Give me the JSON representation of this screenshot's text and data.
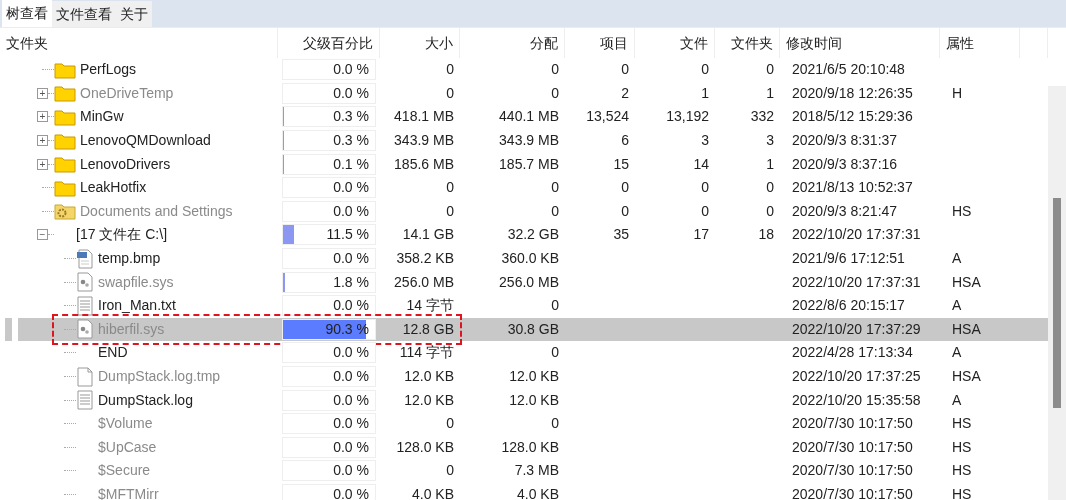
{
  "tabs": [
    {
      "label": "树查看",
      "selected": true
    },
    {
      "label": "文件查看",
      "selected": false
    },
    {
      "label": "关于",
      "selected": false
    }
  ],
  "columns": [
    "文件夹",
    "父级百分比",
    "大小",
    "分配",
    "项目",
    "文件",
    "文件夹",
    "修改时间",
    "属性"
  ],
  "rows": [
    {
      "name": "PerfLogs",
      "kind": "folder",
      "dimmed": false,
      "selected": false,
      "outlined": false,
      "percent": "0.0 %",
      "level": 0,
      "size": "0",
      "allocated": "0",
      "items": "0",
      "files": "0",
      "folders": "0",
      "modified": "2021/6/5 20:10:48"
    },
    {
      "name": "OneDriveTemp",
      "kind": "folder",
      "expander": "+",
      "dimmed": true,
      "selected": false,
      "outlined": false,
      "percent": "0.0 %",
      "level": 0,
      "size": "0",
      "allocated": "0",
      "items": "2",
      "files": "1",
      "folders": "1",
      "modified": "2020/9/18 12:26:35",
      "attributes": "H"
    },
    {
      "name": "MinGw",
      "kind": "folder",
      "expander": "+",
      "dimmed": false,
      "selected": false,
      "outlined": false,
      "percent": "0.3 %",
      "level": 0.003,
      "size": "418.1 MB",
      "allocated": "440.1 MB",
      "items": "13,524",
      "files": "13,192",
      "folders": "332",
      "modified": "2018/5/12 15:29:36"
    },
    {
      "name": "LenovoQMDownload",
      "kind": "folder",
      "expander": "+",
      "dimmed": false,
      "selected": false,
      "outlined": false,
      "percent": "0.3 %",
      "level": 0.003,
      "size": "343.9 MB",
      "allocated": "343.9 MB",
      "items": "6",
      "files": "3",
      "folders": "3",
      "modified": "2020/9/3 8:31:37"
    },
    {
      "name": "LenovoDrivers",
      "kind": "folder",
      "expander": "+",
      "dimmed": false,
      "selected": false,
      "outlined": false,
      "percent": "0.1 %",
      "level": 0.001,
      "size": "185.6 MB",
      "allocated": "185.7 MB",
      "items": "15",
      "files": "14",
      "folders": "1",
      "modified": "2020/9/3 8:37:16"
    },
    {
      "name": "LeakHotfix",
      "kind": "folder",
      "dimmed": false,
      "selected": false,
      "outlined": false,
      "percent": "0.0 %",
      "level": 0,
      "size": "0",
      "allocated": "0",
      "items": "0",
      "files": "0",
      "folders": "0",
      "modified": "2021/8/13 10:52:37"
    },
    {
      "name": "Documents and Settings",
      "kind": "settings-folder",
      "dimmed": true,
      "selected": false,
      "outlined": false,
      "percent": "0.0 %",
      "level": 0,
      "size": "0",
      "allocated": "0",
      "items": "0",
      "files": "0",
      "folders": "0",
      "modified": "2020/9/3 8:21:47",
      "attributes": "HS"
    },
    {
      "name": "[17 文件在 C:\\]",
      "kind": "none",
      "expander": "−",
      "dimmed": false,
      "selected": false,
      "outlined": false,
      "percent": "11.5 %",
      "level": 0.115,
      "size": "14.1 GB",
      "allocated": "32.2 GB",
      "items": "35",
      "files": "17",
      "folders": "18",
      "modified": "2022/10/20 17:37:31",
      "children": [
        {
          "name": "temp.bmp",
          "kind": "image",
          "dimmed": false,
          "selected": false,
          "outlined": false,
          "percent": "0.0 %",
          "level": 0,
          "size": "358.2 KB",
          "allocated": "360.0 KB",
          "modified": "2021/9/6 17:12:51",
          "attributes": "A"
        },
        {
          "name": "swapfile.sys",
          "kind": "system",
          "dimmed": true,
          "selected": false,
          "outlined": false,
          "percent": "1.8 %",
          "level": 0.018,
          "size": "256.0 MB",
          "allocated": "256.0 MB",
          "modified": "2022/10/20 17:37:31",
          "attributes": "HSA"
        },
        {
          "name": "Iron_Man.txt",
          "kind": "text",
          "dimmed": false,
          "selected": false,
          "outlined": false,
          "percent": "0.0 %",
          "level": 0,
          "size": "14 字节",
          "allocated": "0",
          "modified": "2022/8/6 20:15:17",
          "attributes": "A"
        },
        {
          "name": "hiberfil.sys",
          "kind": "system",
          "dimmed": true,
          "selected": true,
          "outlined": true,
          "percent": "90.3 %",
          "level": 0.903,
          "size": "12.8 GB",
          "allocated": "30.8 GB",
          "modified": "2022/10/20 17:37:29",
          "attributes": "HSA"
        },
        {
          "name": "END",
          "kind": "none",
          "dimmed": false,
          "selected": false,
          "outlined": false,
          "percent": "0.0 %",
          "level": 0,
          "size": "114 字节",
          "allocated": "0",
          "modified": "2022/4/28 17:13:34",
          "attributes": "A"
        },
        {
          "name": "DumpStack.log.tmp",
          "kind": "file",
          "dimmed": true,
          "selected": false,
          "outlined": false,
          "percent": "0.0 %",
          "level": 0,
          "size": "12.0 KB",
          "allocated": "12.0 KB",
          "modified": "2022/10/20 17:37:25",
          "attributes": "HSA"
        },
        {
          "name": "DumpStack.log",
          "kind": "text",
          "dimmed": false,
          "selected": false,
          "outlined": false,
          "percent": "0.0 %",
          "level": 0,
          "size": "12.0 KB",
          "allocated": "12.0 KB",
          "modified": "2022/10/20 15:35:58",
          "attributes": "A"
        },
        {
          "name": "$Volume",
          "kind": "none",
          "dimmed": true,
          "selected": false,
          "outlined": false,
          "percent": "0.0 %",
          "level": 0,
          "size": "0",
          "allocated": "0",
          "modified": "2020/7/30 10:17:50",
          "attributes": "HS"
        },
        {
          "name": "$UpCase",
          "kind": "none",
          "dimmed": true,
          "selected": false,
          "outlined": false,
          "percent": "0.0 %",
          "level": 0,
          "size": "128.0 KB",
          "allocated": "128.0 KB",
          "modified": "2020/7/30 10:17:50",
          "attributes": "HS"
        },
        {
          "name": "$Secure",
          "kind": "none",
          "dimmed": true,
          "selected": false,
          "outlined": false,
          "percent": "0.0 %",
          "level": 0,
          "size": "0",
          "allocated": "7.3 MB",
          "modified": "2020/7/30 10:17:50",
          "attributes": "HS"
        },
        {
          "name": "$MFTMirr",
          "kind": "none",
          "dimmed": true,
          "selected": false,
          "outlined": false,
          "percent": "0.0 %",
          "level": 0,
          "size": "4.0 KB",
          "allocated": "4.0 KB",
          "modified": "2020/7/30 10:17:50",
          "attributes": "HS"
        }
      ]
    }
  ]
}
